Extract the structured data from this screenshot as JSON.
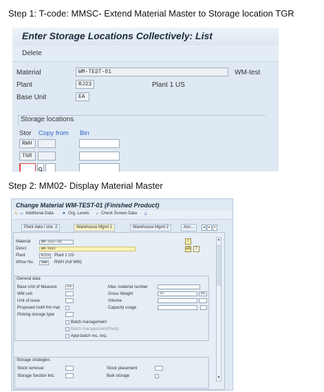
{
  "step1": {
    "heading": "Step 1: T-code: MMSC- Extend Material Master to Storage location TGR",
    "title": "Enter Storage Locations Collectively: List",
    "toolbar": {
      "delete": "Delete"
    },
    "fields": {
      "material_label": "Material",
      "material_value": "WM-TEST-01",
      "material_desc": "WM-test",
      "plant_label": "Plant",
      "plant_value": "RJ23",
      "plant_desc": "Plant 1 US",
      "base_unit_label": "Base Unit",
      "base_unit_value": "EA"
    },
    "section": "Storage locations",
    "columns": {
      "stor": "Stor",
      "copy_from": "Copy from",
      "bin": "Bin"
    },
    "rows": [
      "RWH",
      "TGR",
      ""
    ]
  },
  "step2": {
    "heading": "Step 2: MM02- Display Material Master",
    "title": "Change Material WM-TEST-01 (Finished Product)",
    "toolbar": {
      "additional": "Additional Data",
      "org": "Org. Levels",
      "check": "Check Screen Data"
    },
    "tabs": [
      "Plant data / stor. 2",
      "Warehouse Mgmt 1",
      "Warehouse Mgmt 2",
      "Acc..."
    ],
    "header": {
      "material_label": "Material",
      "material_value": "WM-TEST-01",
      "descr_label": "Descr.",
      "descr_value": "WM-test",
      "plant_label": "Plant",
      "plant_value": "RJ23",
      "plant_desc": "Plant 1 US",
      "whse_label": "Whse No.",
      "whse_value": "RWH",
      "whse_desc": "RWH (full WM)"
    },
    "general": {
      "heading": "General data",
      "base_uom": "Base Unit of Measure",
      "base_uom_value": "EA",
      "wm_unit": "WM unit",
      "unit_issue": "Unit of issue",
      "proposed_uom": "Proposed UoM frm mat",
      "picking_type": "Picking storage type",
      "max_material_number": "Max. material number",
      "gross_weight": "Gross Weight",
      "gross_weight_value": "15",
      "gross_weight_unit": "KG",
      "volume": "Volume",
      "capacity_usage": "Capacity usage",
      "batch_mgmt": "Batch management",
      "batch_mgmt_plant": "Batch management(Plant)",
      "appr_batch": "Appr.batch rec. req."
    },
    "strategies": {
      "heading": "Storage strategies",
      "stock_removal": "Stock removal",
      "stock_placement": "Stock placement",
      "storage_section": "Storage Section Ind.",
      "bulk_storage": "Bulk storage"
    }
  }
}
